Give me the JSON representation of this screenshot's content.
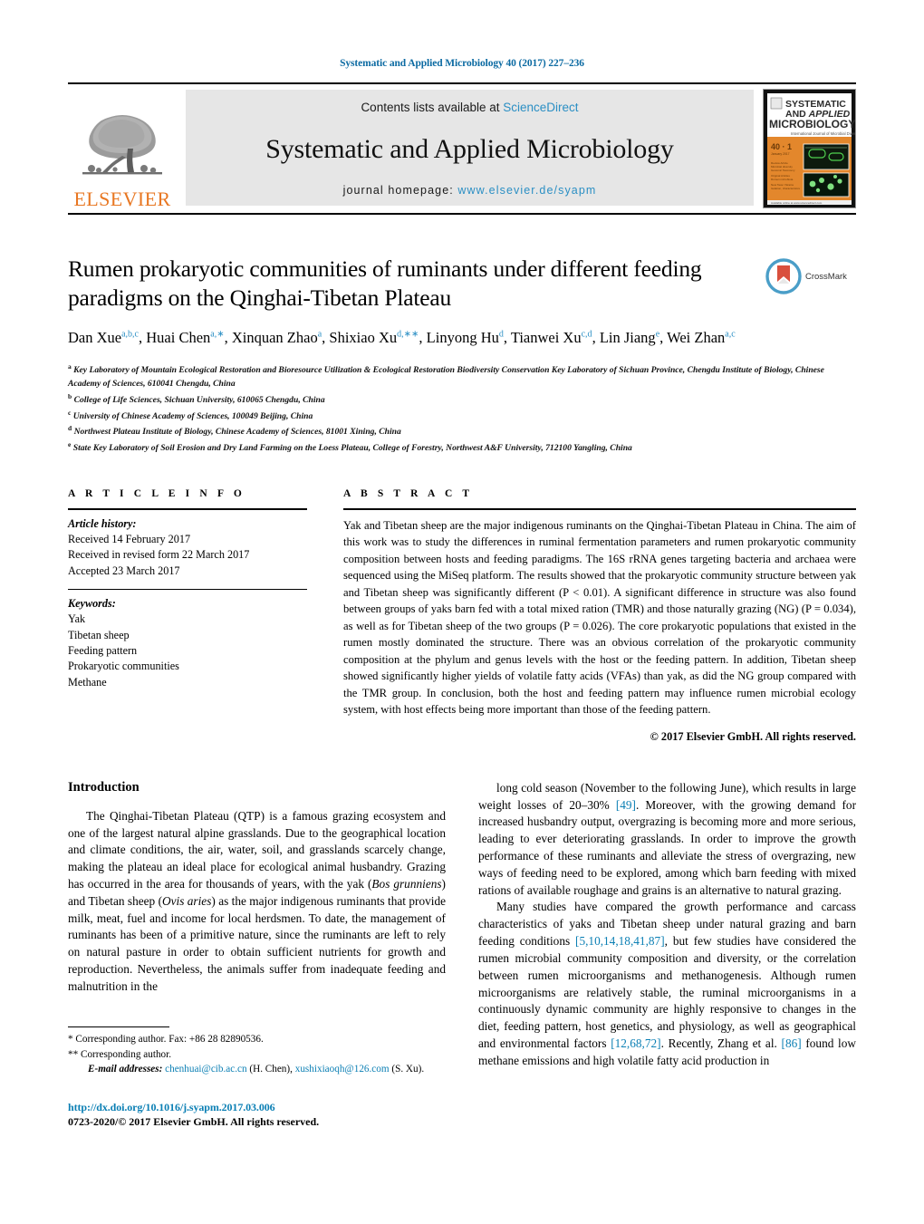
{
  "running_head": "Systematic and Applied Microbiology 40 (2017) 227–236",
  "masthead": {
    "publisher_logo_name": "elsevier-tree-logo",
    "publisher_wordmark": "ELSEVIER",
    "contents_prefix": "Contents lists available at ",
    "contents_link": "ScienceDirect",
    "journal_title": "Systematic and Applied Microbiology",
    "homepage_prefix": "journal homepage: ",
    "homepage_link": "www.elsevier.de/syapm",
    "cover": {
      "line1": "SYSTEMATIC",
      "line2": "AND APPLIED",
      "line3": "MICROBIOLOGY",
      "subtitle": "International Journal of Microbial Diversity",
      "volume": "40 - 1",
      "issue_note": "January 2017"
    }
  },
  "article": {
    "title": "Rumen prokaryotic communities of ruminants under different feeding paradigms on the Qinghai-Tibetan Plateau",
    "crossmark_label": "CrossMark",
    "authors_html": "Dan Xue<sup>a,b,c</sup>, Huai Chen<sup>a,∗</sup>, Xinquan Zhao<sup>a</sup>, Shixiao Xu<sup>d,∗∗</sup>, Linyong Hu<sup>d</sup>, Tianwei Xu<sup>c,d</sup>, Lin Jiang<sup>e</sup>, Wei Zhan<sup>a,c</sup>",
    "affiliations": [
      {
        "mark": "a",
        "text": "Key Laboratory of Mountain Ecological Restoration and Bioresource Utilization & Ecological Restoration Biodiversity Conservation Key Laboratory of Sichuan Province, Chengdu Institute of Biology, Chinese Academy of Sciences, 610041 Chengdu, China"
      },
      {
        "mark": "b",
        "text": "College of Life Sciences, Sichuan University, 610065 Chengdu, China"
      },
      {
        "mark": "c",
        "text": "University of Chinese Academy of Sciences, 100049 Beijing, China"
      },
      {
        "mark": "d",
        "text": "Northwest Plateau Institute of Biology, Chinese Academy of Sciences, 81001 Xining, China"
      },
      {
        "mark": "e",
        "text": "State Key Laboratory of Soil Erosion and Dry Land Farming on the Loess Plateau, College of Forestry, Northwest A&F University, 712100 Yangling, China"
      }
    ]
  },
  "article_info": {
    "heading": "A R T I C L E   I N F O",
    "history_label": "Article history:",
    "history": [
      "Received 14 February 2017",
      "Received in revised form 22 March 2017",
      "Accepted 23 March 2017"
    ],
    "keywords_label": "Keywords:",
    "keywords": [
      "Yak",
      "Tibetan sheep",
      "Feeding pattern",
      "Prokaryotic communities",
      "Methane"
    ]
  },
  "abstract": {
    "heading": "A B S T R A C T",
    "text": "Yak and Tibetan sheep are the major indigenous ruminants on the Qinghai-Tibetan Plateau in China. The aim of this work was to study the differences in ruminal fermentation parameters and rumen prokaryotic community composition between hosts and feeding paradigms. The 16S rRNA genes targeting bacteria and archaea were sequenced using the MiSeq platform. The results showed that the prokaryotic community structure between yak and Tibetan sheep was significantly different (P < 0.01). A significant difference in structure was also found between groups of yaks barn fed with a total mixed ration (TMR) and those naturally grazing (NG) (P = 0.034), as well as for Tibetan sheep of the two groups (P = 0.026). The core prokaryotic populations that existed in the rumen mostly dominated the structure. There was an obvious correlation of the prokaryotic community composition at the phylum and genus levels with the host or the feeding pattern. In addition, Tibetan sheep showed significantly higher yields of volatile fatty acids (VFAs) than yak, as did the NG group compared with the TMR group. In conclusion, both the host and feeding pattern may influence rumen microbial ecology system, with host effects being more important than those of the feeding pattern.",
    "copyright": "© 2017 Elsevier GmbH. All rights reserved."
  },
  "introduction": {
    "heading": "Introduction",
    "left_paragraph_1_html": "The Qinghai-Tibetan Plateau (QTP) is a famous grazing ecosystem and one of the largest natural alpine grasslands. Due to the geographical location and climate conditions, the air, water, soil, and grasslands scarcely change, making the plateau an ideal place for ecological animal husbandry. Grazing has occurred in the area for thousands of years, with the yak (<span class=\"ital\">Bos grunniens</span>) and Tibetan sheep (<span class=\"ital\">Ovis aries</span>) as the major indigenous ruminants that provide milk, meat, fuel and income for local herdsmen. To date, the management of ruminants has been of a primitive nature, since the ruminants are left to rely on natural pasture in order to obtain sufficient nutrients for growth and reproduction. Nevertheless, the animals suffer from inadequate feeding and malnutrition in the",
    "right_paragraph_1_html": "long cold season (November to the following June), which results in large weight losses of 20–30% <span class=\"ref\">[49]</span>. Moreover, with the growing demand for increased husbandry output, overgrazing is becoming more and more serious, leading to ever deteriorating grasslands. In order to improve the growth performance of these ruminants and alleviate the stress of overgrazing, new ways of feeding need to be explored, among which barn feeding with mixed rations of available roughage and grains is an alternative to natural grazing.",
    "right_paragraph_2_html": "Many studies have compared the growth performance and carcass characteristics of yaks and Tibetan sheep under natural grazing and barn feeding conditions <span class=\"ref\">[5,10,14,18,41,87]</span>, but few studies have considered the rumen microbial community composition and diversity, or the correlation between rumen microorganisms and methanogenesis. Although rumen microorganisms are relatively stable, the ruminal microorganisms in a continuously dynamic community are highly responsive to changes in the diet, feeding pattern, host genetics, and physiology, as well as geographical and environmental factors <span class=\"ref\">[12,68,72]</span>. Recently, Zhang et al. <span class=\"ref\">[86]</span> found low methane emissions and high volatile fatty acid production in"
  },
  "footnotes": {
    "corresponding_1": "* Corresponding author. Fax: +86 28 82890536.",
    "corresponding_2": "** Corresponding author.",
    "email_label": "E-mail addresses:",
    "email_1": "chenhuai@cib.ac.cn",
    "email_1_owner": "(H. Chen),",
    "email_2": "xushixiaoqh@126.com",
    "email_2_owner": "(S. Xu).",
    "doi": "http://dx.doi.org/10.1016/j.syapm.2017.03.006",
    "issn_copyright": "0723-2020/© 2017 Elsevier GmbH. All rights reserved."
  },
  "colors": {
    "link_blue": "#0b7fb4",
    "elsevier_orange": "#E87722",
    "band_grey": "#e6e6e6",
    "crossmark_red": "#d94f3d",
    "crossmark_blue": "#4a9ec8"
  }
}
